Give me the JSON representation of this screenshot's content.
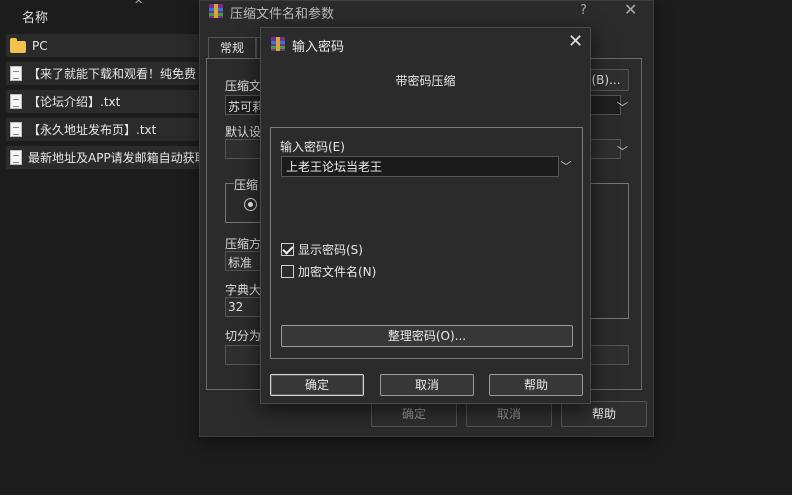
{
  "explorer": {
    "column_name": "名称",
    "sort_indicator": "^",
    "items": [
      {
        "label": "PC",
        "icon": "folder-icon"
      },
      {
        "label": "【来了就能下载和观看！纯免费",
        "icon": "text-file-icon"
      },
      {
        "label": "【论坛介绍】.txt",
        "icon": "text-file-icon"
      },
      {
        "label": "【永久地址发布页】.txt",
        "icon": "text-file-icon"
      },
      {
        "label": "最新地址及APP请发邮箱自动获取",
        "icon": "text-file-icon"
      }
    ]
  },
  "archive_dialog": {
    "title": "压缩文件名和参数",
    "help": "?",
    "close": "✕",
    "tab_general": "常规",
    "archive_name_label": "压缩文",
    "archive_name_value": "苏可莉",
    "browse_button": "(B)...",
    "default_profile_label": "默认设",
    "format_group_label": "压缩",
    "method_label": "压缩方",
    "method_value": "标准",
    "dict_label": "字典大",
    "dict_value": "32",
    "split_label": "切分为",
    "ok": "确定",
    "cancel": "取消",
    "help_button": "帮助"
  },
  "password_dialog": {
    "title": "输入密码",
    "close": "✕",
    "heading": "带密码压缩",
    "password_label": "输入密码(E)",
    "password_value": "上老王论坛当老王",
    "show_password": {
      "label": "显示密码(S)",
      "checked": true
    },
    "encrypt_filenames": {
      "label": "加密文件名(N)",
      "checked": false
    },
    "organize_button": "整理密码(O)...",
    "ok": "确定",
    "cancel": "取消",
    "help": "帮助"
  },
  "colors": {
    "background": "#1c1c1c",
    "dialog": "#2b2b2b",
    "input": "#1b1b1b",
    "folder": "#f2c14e"
  }
}
